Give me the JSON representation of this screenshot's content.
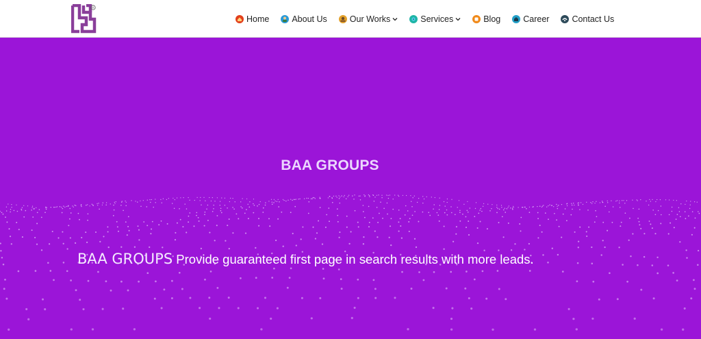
{
  "brand": {
    "name": "BAA GROUPS",
    "logo_mark": "®"
  },
  "nav": {
    "items": [
      {
        "label": "Home",
        "icon": "home-icon",
        "color": "#e2401c",
        "dropdown": false
      },
      {
        "label": "About Us",
        "icon": "about-icon",
        "color": "#2a9bd8",
        "dropdown": false
      },
      {
        "label": "Our Works",
        "icon": "works-icon",
        "color": "#e3a12b",
        "dropdown": true
      },
      {
        "label": "Services",
        "icon": "services-icon",
        "color": "#1fb5a6",
        "dropdown": true
      },
      {
        "label": "Blog",
        "icon": "blog-icon",
        "color": "#f08a1a",
        "dropdown": false
      },
      {
        "label": "Career",
        "icon": "career-icon",
        "color": "#23a0c8",
        "dropdown": false
      },
      {
        "label": "Contact Us",
        "icon": "contact-icon",
        "color": "#2d4a5a",
        "dropdown": false
      }
    ]
  },
  "hero": {
    "title": "BAA GROUPS",
    "subtitle_brand": "BAA GROUPS",
    "subtitle_text": " Provide guaranteed first page in search results with more leads.",
    "background": "#9b15d8",
    "title_color": "#ecd7ff"
  }
}
